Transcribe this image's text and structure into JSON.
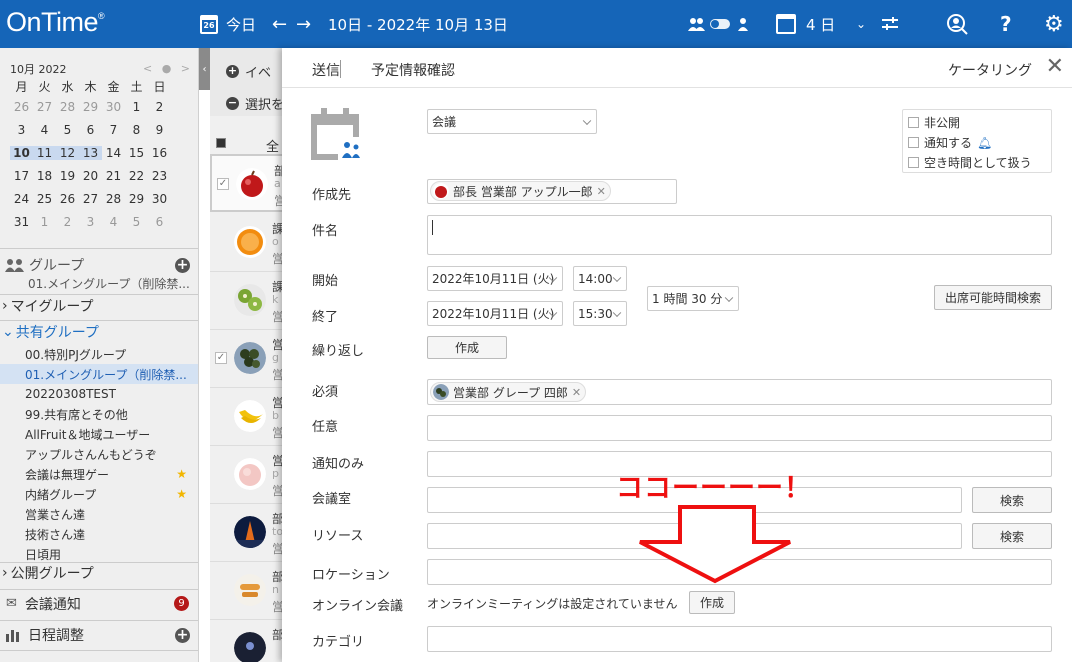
{
  "topbar": {
    "logo": "OnTime",
    "logo_mark": "®",
    "cal_day": "26",
    "today_label": "今日",
    "date_range": "10日 - 2022年 10月 13日",
    "days_label": "4 日",
    "bg_color": "#1565b8"
  },
  "sidebar": {
    "month_label": "10月 2022",
    "weekdays": [
      "月",
      "火",
      "水",
      "木",
      "金",
      "土",
      "日"
    ],
    "weeks": [
      [
        "26",
        "27",
        "28",
        "29",
        "30",
        "1",
        "2"
      ],
      [
        "3",
        "4",
        "5",
        "6",
        "7",
        "8",
        "9"
      ],
      [
        "10",
        "11",
        "12",
        "13",
        "14",
        "15",
        "16"
      ],
      [
        "17",
        "18",
        "19",
        "20",
        "21",
        "22",
        "23"
      ],
      [
        "24",
        "25",
        "26",
        "27",
        "28",
        "29",
        "30"
      ],
      [
        "31",
        "1",
        "2",
        "3",
        "4",
        "5",
        "6"
      ]
    ],
    "group_header": "グループ",
    "group_current": "01.メイングループ（削除禁...",
    "my_group": "マイグループ",
    "shared_group": "共有グループ",
    "shared_items": [
      "00.特別PJグループ",
      "01.メイングループ（削除禁...",
      "20220308TEST",
      "99.共有席とその他",
      "AllFruit＆地域ユーザー",
      "アップルさんんもどうぞ",
      "会議は無理ゲー",
      "内緒グループ",
      "営業さん達",
      "技術さん達",
      "日頃用"
    ],
    "public_group": "公開グループ",
    "meeting_notice": "会議通知",
    "meeting_badge": "9",
    "schedule_adjust": "日程調整"
  },
  "middle": {
    "add_event": "イベ",
    "select": "選択を",
    "all_label": "全て",
    "rows": [
      {
        "t1": "部",
        "t2": "a",
        "t3": "営"
      },
      {
        "t1": "課",
        "t2": "o",
        "t3": "営"
      },
      {
        "t1": "課",
        "t2": "k",
        "t3": "営"
      },
      {
        "t1": "営",
        "t2": "g",
        "t3": "営"
      },
      {
        "t1": "営",
        "t2": "b",
        "t3": "営"
      },
      {
        "t1": "営",
        "t2": "p",
        "t3": "営"
      },
      {
        "t1": "部",
        "t2": "to",
        "t3": "営"
      },
      {
        "t1": "部",
        "t2": "n",
        "t3": "営"
      },
      {
        "t1": "部",
        "t2": "",
        "t3": ""
      }
    ]
  },
  "dialog": {
    "tab_send": "送信",
    "tab_check": "予定情報確認",
    "catering": "ケータリング",
    "type_value": "会議",
    "options": [
      "非公開",
      "通知する",
      "空き時間として扱う"
    ],
    "author_label": "作成先",
    "author_chip": "部長 営業部 アップル一郎",
    "subject_label": "件名",
    "start_label": "開始",
    "start_date": "2022年10月11日 (火)",
    "start_time": "14:00",
    "end_label": "終了",
    "end_date": "2022年10月11日 (火)",
    "end_time": "15:30",
    "duration": "1 時間 30 分",
    "availability_button": "出席可能時間検索",
    "repeat_label": "繰り返し",
    "create_button": "作成",
    "required_label": "必須",
    "required_chip": "営業部 グレープ 四郎",
    "optional_label": "任意",
    "notify_only_label": "通知のみ",
    "room_label": "会議室",
    "search_button": "検索",
    "resource_label": "リソース",
    "location_label": "ロケーション",
    "online_label": "オンライン会議",
    "online_text": "オンラインミーティングは設定されていません",
    "online_create_button": "作成",
    "category_label": "カテゴリ"
  },
  "annotation": {
    "text": "ココーーーー！",
    "color": "#ee1010"
  }
}
